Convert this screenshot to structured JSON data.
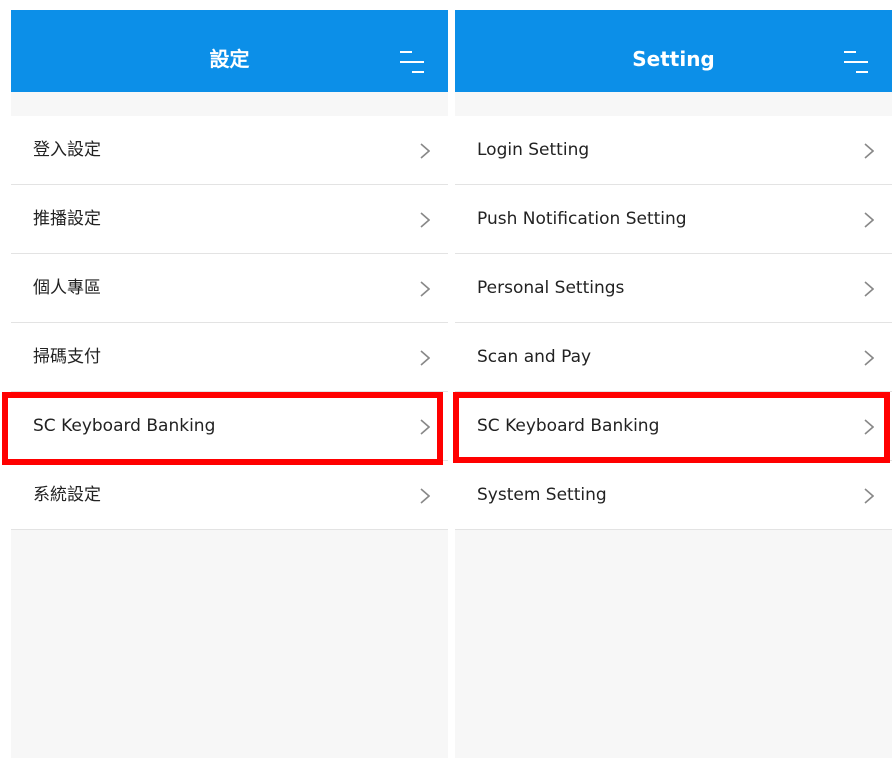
{
  "screens": [
    {
      "title": "設定",
      "items": [
        {
          "label": "登入設定"
        },
        {
          "label": "推播設定"
        },
        {
          "label": "個人專區"
        },
        {
          "label": "掃碼支付"
        },
        {
          "label": "SC Keyboard Banking"
        },
        {
          "label": "系統設定"
        }
      ]
    },
    {
      "title": "Setting",
      "items": [
        {
          "label": "Login Setting"
        },
        {
          "label": "Push Notification Setting"
        },
        {
          "label": "Personal Settings"
        },
        {
          "label": "Scan and Pay"
        },
        {
          "label": "SC Keyboard Banking"
        },
        {
          "label": "System Setting"
        }
      ]
    }
  ],
  "colors": {
    "header": "#0c8fe8",
    "highlight": "#ff0000",
    "background": "#f7f7f7"
  },
  "icons": [
    "menu-icon",
    "chevron-right-icon"
  ]
}
